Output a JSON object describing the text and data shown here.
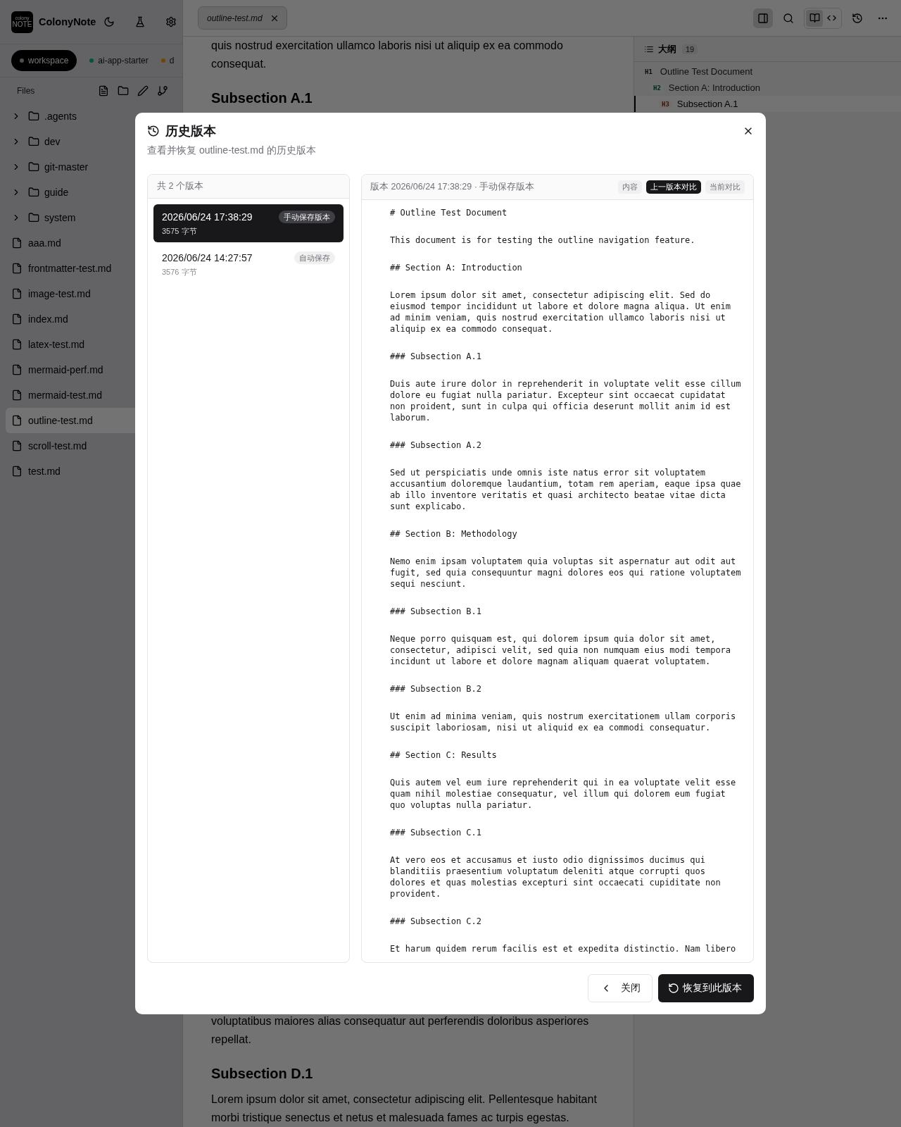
{
  "sidebar": {
    "logo": {
      "small": "colony",
      "big": "NOTE"
    },
    "app_name": "ColonyNote",
    "workspaces": [
      {
        "label": "workspace",
        "selected": true,
        "color": "#4d4d52"
      },
      {
        "label": "ai-app-starter",
        "selected": false,
        "color": "#07533a"
      },
      {
        "label": "d",
        "selected": false,
        "color": "#6e4705"
      }
    ],
    "files_label": "Files",
    "tree": [
      {
        "kind": "folder",
        "name": ".agents",
        "expanded": false
      },
      {
        "kind": "folder",
        "name": "dev",
        "expanded": false
      },
      {
        "kind": "folder",
        "name": "git-master",
        "expanded": false
      },
      {
        "kind": "folder",
        "name": "guide",
        "expanded": false
      },
      {
        "kind": "folder",
        "name": "system",
        "expanded": false
      },
      {
        "kind": "file",
        "name": "aaa.md",
        "selected": false
      },
      {
        "kind": "file",
        "name": "frontmatter-test.md",
        "selected": false
      },
      {
        "kind": "file",
        "name": "image-test.md",
        "selected": false
      },
      {
        "kind": "file",
        "name": "index.md",
        "selected": false
      },
      {
        "kind": "file",
        "name": "latex-test.md",
        "selected": false
      },
      {
        "kind": "file",
        "name": "mermaid-perf.md",
        "selected": false
      },
      {
        "kind": "file",
        "name": "mermaid-test.md",
        "selected": false
      },
      {
        "kind": "file",
        "name": "outline-test.md",
        "selected": true
      },
      {
        "kind": "file",
        "name": "scroll-test.md",
        "selected": false
      },
      {
        "kind": "file",
        "name": "test.md",
        "selected": false
      }
    ]
  },
  "topbar": {
    "tabs": [
      {
        "label": "outline-test.md",
        "selected": true
      }
    ],
    "panel_toggle": {
      "on": true
    },
    "view_modes": [
      {
        "kind": "read",
        "selected": true
      },
      {
        "kind": "source",
        "selected": false
      }
    ]
  },
  "editor": {
    "top_blocks": [
      {
        "kind": "paragraph",
        "text": "quis nostrud exercitation ullamco laboris nisi ut aliquip ex ea commodo consequat."
      },
      {
        "kind": "heading",
        "text": "Subsection A.1"
      }
    ],
    "bottom_blocks": [
      {
        "kind": "paragraph",
        "text": "voluptatibus maiores alias consequatur aut perferendis doloribus asperiores repellat."
      },
      {
        "kind": "heading",
        "text": "Subsection D.1"
      },
      {
        "kind": "paragraph",
        "text": "Lorem ipsum dolor sit amet, consectetur adipiscing elit. Pellentesque habitant morbi tristique senectus et netus et malesuada fames ac turpis egestas."
      }
    ]
  },
  "outline": {
    "title": "大纲",
    "count": "19",
    "items": [
      {
        "level": "H1",
        "text": "Outline Test Document",
        "selected": false,
        "children": [
          {
            "level": "H2",
            "text": "Section A: Introduction",
            "selected": false,
            "children": [
              {
                "level": "H3",
                "text": "Subsection A.1",
                "selected": true
              }
            ]
          }
        ]
      }
    ]
  },
  "modal": {
    "title": "历史版本",
    "subtitle": "查看并恢复 outline-test.md 的历史版本",
    "list_header": "共 2 个版本",
    "versions": [
      {
        "time": "2026/06/24 17:38:29",
        "badge": "手动保存版本",
        "size": "3575 字节",
        "selected": true
      },
      {
        "time": "2026/06/24 14:27:57",
        "badge": "自动保存",
        "size": "3576 字节",
        "selected": false
      }
    ],
    "preview": {
      "title": "版本 2026/06/24 17:38:29 · 手动保存版本",
      "modes": [
        {
          "label": "内容",
          "selected": false
        },
        {
          "label": "上一版本对比",
          "selected": true
        },
        {
          "label": "当前对比",
          "selected": false
        }
      ],
      "lines": [
        "# Outline Test Document",
        "This document is for testing the outline navigation feature.",
        "## Section A: Introduction",
        "Lorem ipsum dolor sit amet, consectetur adipiscing elit. Sed do eiusmod tempor incididunt ut labore et dolore magna aliqua. Ut enim ad minim veniam, quis nostrud exercitation ullamco laboris nisi ut aliquip ex ea commodo consequat.",
        "### Subsection A.1",
        "Duis aute irure dolor in reprehenderit in voluptate velit esse cillum dolore eu fugiat nulla pariatur. Excepteur sint occaecat cupidatat non proident, sunt in culpa qui officia deserunt mollit anim id est laborum.",
        "### Subsection A.2",
        "Sed ut perspiciatis unde omnis iste natus error sit voluptatem accusantium doloremque laudantium, totam rem aperiam, eaque ipsa quae ab illo inventore veritatis et quasi architecto beatae vitae dicta sunt explicabo.",
        "## Section B: Methodology",
        "Nemo enim ipsam voluptatem quia voluptas sit aspernatur aut odit aut fugit, sed quia consequuntur magni dolores eos qui ratione voluptatem sequi nesciunt.",
        "### Subsection B.1",
        "Neque porro quisquam est, qui dolorem ipsum quia dolor sit amet, consectetur, adipisci velit, sed quia non numquam eius modi tempora incidunt ut labore et dolore magnam aliquam quaerat voluptatem.",
        "### Subsection B.2",
        "Ut enim ad minima veniam, quis nostrum exercitationem ullam corporis suscipit laboriosam, nisi ut aliquid ex ea commodi consequatur.",
        "## Section C: Results",
        "Quis autem vel eum iure reprehenderit qui in ea voluptate velit esse quam nihil molestiae consequatur, vel illum qui dolorem eum fugiat quo voluptas nulla pariatur.",
        "### Subsection C.1",
        "At vero eos et accusamus et iusto odio dignissimos ducimus qui blanditiis praesentium voluptatum deleniti atque corrupti quos dolores et quas molestias excepturi sint occaecati cupiditate non provident.",
        "### Subsection C.2",
        "Et harum quidem rerum facilis est et expedita distinctio. Nam libero"
      ]
    },
    "buttons": [
      {
        "kind": "secondary",
        "label": "关闭"
      },
      {
        "kind": "primary",
        "label": "恢复到此版本"
      }
    ]
  }
}
